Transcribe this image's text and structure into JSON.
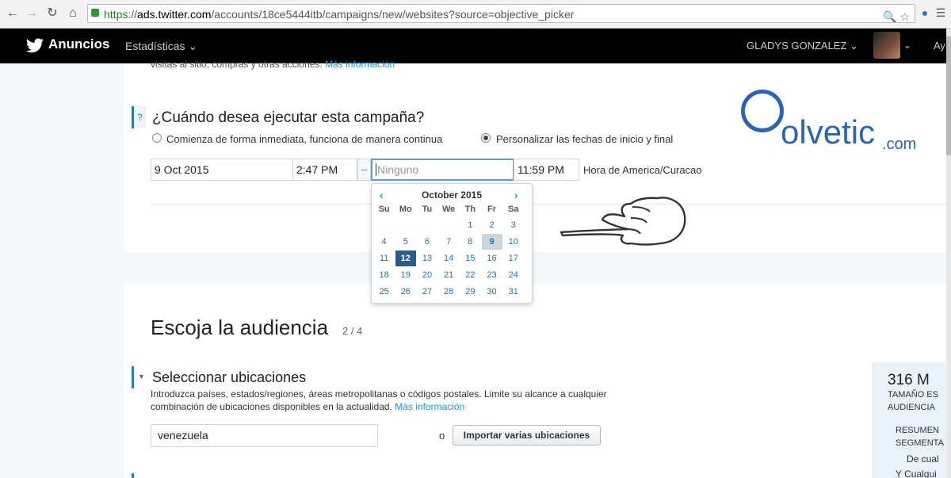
{
  "browser": {
    "back_icon": "arrow-left",
    "forward_icon": "arrow-right",
    "reload_icon": "reload",
    "home_icon": "home",
    "url_scheme": "https://",
    "url_host": "ads.twitter.com",
    "url_path": "/accounts/18ce5444itb/campaigns/new/websites?source=objective_picker"
  },
  "topbar": {
    "brand": "Anuncios",
    "stats_menu": "Estadísticas",
    "user_name": "GLADYS GONZALEZ",
    "more": "Ay"
  },
  "objective": {
    "desc": "visitas al sitio, compras y otras acciones.",
    "more_link": "Más información"
  },
  "schedule": {
    "help_icon": "?",
    "title": "¿Cuándo desea ejecutar esta campaña?",
    "option_immediate": "Comienza de forma inmediata, funciona de manera continua",
    "option_custom": "Personalizar las fechas de inicio y final",
    "selected_option": "custom",
    "start_date": "9 Oct 2015",
    "start_time": "2:47 PM",
    "separator": "–",
    "end_date_placeholder": "Ninguno",
    "end_time": "11:59 PM",
    "timezone": "Hora de America/Curacao"
  },
  "calendar": {
    "month": "October 2015",
    "prev_icon": "‹",
    "next_icon": "›",
    "weekdays": [
      "Su",
      "Mo",
      "Tu",
      "We",
      "Th",
      "Fr",
      "Sa"
    ],
    "weeks": [
      [
        "",
        "",
        "",
        "",
        "1",
        "2",
        "3"
      ],
      [
        "4",
        "5",
        "6",
        "7",
        "8",
        "9",
        "10"
      ],
      [
        "11",
        "12",
        "13",
        "14",
        "15",
        "16",
        "17"
      ],
      [
        "18",
        "19",
        "20",
        "21",
        "22",
        "23",
        "24"
      ],
      [
        "25",
        "26",
        "27",
        "28",
        "29",
        "30",
        "31"
      ]
    ],
    "today": "9",
    "selected": "12"
  },
  "logo": {
    "word": "olvetic",
    "suffix": ".com"
  },
  "audience": {
    "title": "Escoja la audiencia",
    "step": "2 / 4",
    "locations_title": "Seleccionar ubicaciones",
    "locations_desc": "Introduzca países, estados/regiones, áreas metropolitanas o códigos postales. Limite su alcance a cualquier combinación de ubicaciones disponibles en la actualidad.",
    "locations_more": "Más información",
    "location_value": "venezuela",
    "or_label": "o",
    "import_button": "Importar varias ubicaciones"
  },
  "audience_panel": {
    "size": "316 M",
    "size_label_1": "TAMAÑO ES",
    "size_label_2": "AUDIENCIA",
    "summary_1": "RESUMEN",
    "summary_2": "SEGMENTA",
    "item_1": "De cual",
    "item_2": "Y  Cualqui"
  },
  "colors": {
    "accent": "#1b95e0",
    "selected_day": "#2b5c8f",
    "topbar": "#000000",
    "logo": "#2b64b5"
  }
}
